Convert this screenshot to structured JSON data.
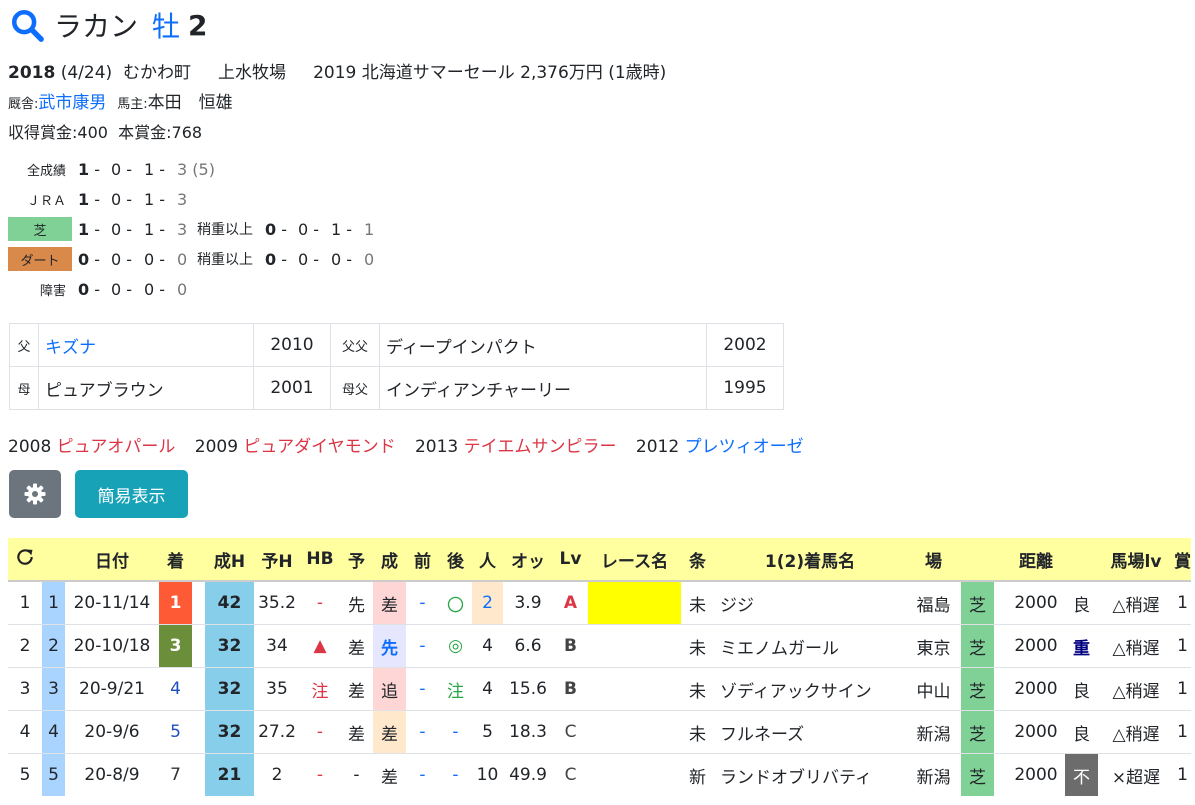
{
  "horse": {
    "name": "ラカン",
    "sex": "牡",
    "age": "2"
  },
  "info": {
    "birth_year": "2018",
    "birth_date": "(4/24)",
    "birthplace": "むかわ町",
    "farm": "上水牧場",
    "sale": "2019 北海道サマーセール 2,376万円 (1歳時)",
    "trainer_label": "厩舎:",
    "trainer": "武市康男",
    "owner_label": "馬主:",
    "owner": "本田　恒雄",
    "earned_label": "収得賞金:",
    "earned": "400",
    "prize_label": "本賞金:",
    "prize": "768"
  },
  "records": [
    {
      "label": "全成績",
      "vals": [
        "1",
        "0",
        "1",
        "3"
      ],
      "extra": "(5)"
    },
    {
      "label": "ＪＲＡ",
      "vals": [
        "1",
        "0",
        "1",
        "3"
      ]
    },
    {
      "label": "芝",
      "vals": [
        "1",
        "0",
        "1",
        "3"
      ],
      "sub_label": "稍重以上",
      "sub_vals": [
        "0",
        "0",
        "1",
        "1"
      ]
    },
    {
      "label": "ダート",
      "vals": [
        "0",
        "0",
        "0",
        "0"
      ],
      "sub_label": "稍重以上",
      "sub_vals": [
        "0",
        "0",
        "0",
        "0"
      ]
    },
    {
      "label": "障害",
      "vals": [
        "0",
        "0",
        "0",
        "0"
      ]
    }
  ],
  "pedigree": {
    "sire_label": "父",
    "sire": "キズナ",
    "sire_year": "2010",
    "sire_sire_label": "父父",
    "sire_sire": "ディープインパクト",
    "sire_sire_year": "2002",
    "dam_label": "母",
    "dam": "ピュアブラウン",
    "dam_year": "2001",
    "dam_sire_label": "母父",
    "dam_sire": "インディアンチャーリー",
    "dam_sire_year": "1995"
  },
  "siblings": [
    {
      "year": "2008",
      "name": "ピュアオパール",
      "color": "#dc3545"
    },
    {
      "year": "2009",
      "name": "ピュアダイヤモンド",
      "color": "#dc3545"
    },
    {
      "year": "2013",
      "name": "テイエムサンピラー",
      "color": "#dc3545"
    },
    {
      "year": "2012",
      "name": "プレツィオーゼ",
      "color": "#0d6efd"
    }
  ],
  "buttons": {
    "gear_icon": "gear-icon",
    "simple": "簡易表示"
  },
  "table": {
    "headers": [
      "",
      "",
      "日付",
      "着",
      "",
      "成H",
      "予H",
      "HB",
      "予",
      "成",
      "前",
      "後",
      "人",
      "オッ",
      "Lv",
      "レース名",
      "条",
      "1(2)着馬名",
      "場",
      "",
      "",
      "距離",
      "",
      "馬場lv",
      "賞"
    ],
    "rows": [
      [
        "1",
        "1",
        "20-11/14",
        "1",
        "",
        "42",
        "35.2",
        "-",
        "先",
        "差",
        "-",
        "〇",
        "2",
        "3.9",
        "A",
        "",
        "未",
        "ジジ",
        "福島",
        "芝",
        "",
        "2000",
        "良",
        "△稍遅",
        "1"
      ],
      [
        "2",
        "2",
        "20-10/18",
        "3",
        "",
        "32",
        "34",
        "▲",
        "差",
        "先",
        "-",
        "◎",
        "4",
        "6.6",
        "B",
        "",
        "未",
        "ミエノムガール",
        "東京",
        "芝",
        "",
        "2000",
        "重",
        "△稍遅",
        "1"
      ],
      [
        "3",
        "3",
        "20-9/21",
        "4",
        "",
        "32",
        "35",
        "注",
        "差",
        "追",
        "-",
        "注",
        "4",
        "15.6",
        "B",
        "",
        "未",
        "ゾディアックサイン",
        "中山",
        "芝",
        "",
        "2000",
        "良",
        "△稍遅",
        "1"
      ],
      [
        "4",
        "4",
        "20-9/6",
        "5",
        "",
        "32",
        "27.2",
        "-",
        "差",
        "差",
        "-",
        "-",
        "5",
        "18.3",
        "C",
        "",
        "未",
        "フルネーズ",
        "新潟",
        "芝",
        "",
        "2000",
        "良",
        "△稍遅",
        "1"
      ],
      [
        "5",
        "5",
        "20-8/9",
        "7",
        "",
        "21",
        "2",
        "-",
        "-",
        "差",
        "-",
        "-",
        "10",
        "49.9",
        "C",
        "",
        "新",
        "ランドオブリバティ",
        "新潟",
        "芝",
        "",
        "2000",
        "不",
        "×超遅",
        "1"
      ]
    ]
  }
}
